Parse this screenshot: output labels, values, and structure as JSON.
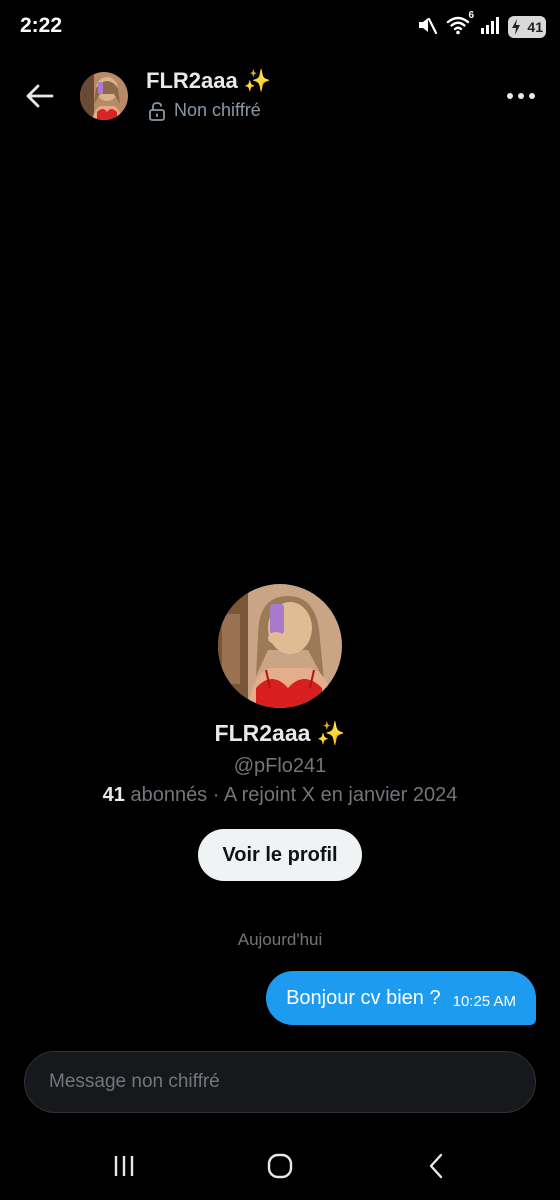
{
  "status_bar": {
    "time": "2:22",
    "wifi_badge": "6",
    "battery_level": "41",
    "icons": [
      "mute-icon",
      "wifi-icon",
      "signal-icon",
      "battery-charging-icon"
    ]
  },
  "header": {
    "name": "FLR2aaa ✨",
    "encryption_status": "Non chiffré",
    "icons": [
      "back-arrow-icon",
      "lock-open-icon",
      "more-icon"
    ]
  },
  "profile": {
    "name": "FLR2aaa ✨",
    "handle": "@pFlo241",
    "followers_count": "41",
    "followers_label": " abonnés · A rejoint X en janvier 2024",
    "view_profile_label": "Voir le profil"
  },
  "conversation": {
    "day_label": "Aujourd'hui",
    "messages": [
      {
        "text": "Bonjour cv bien ?",
        "time": "10:25 AM"
      }
    ]
  },
  "composer": {
    "placeholder": "Message non chiffré",
    "value": ""
  },
  "nav_bar": {
    "icons": [
      "recents-icon",
      "home-icon",
      "back-icon"
    ]
  },
  "colors": {
    "background": "#000000",
    "accent": "#1d9bf0",
    "muted_text": "#71767b",
    "button_bg": "#eff3f4"
  }
}
